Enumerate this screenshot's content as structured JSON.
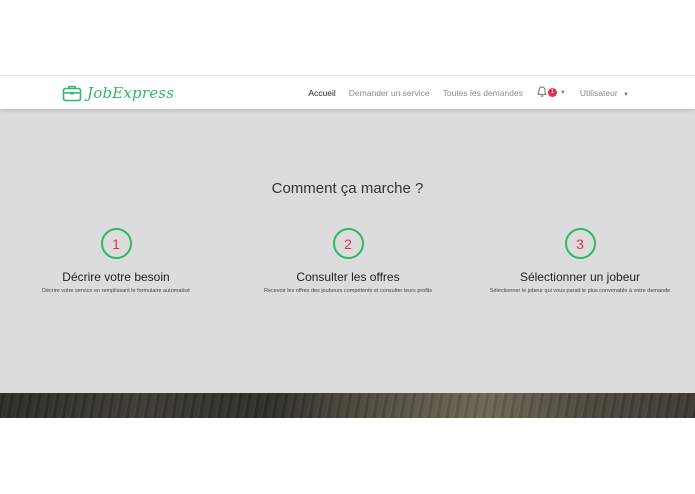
{
  "brand": {
    "name": "JobExpress",
    "color": "#2fb86a",
    "icon": "briefcase-icon"
  },
  "nav": {
    "links": [
      "Accueil",
      "Demander un service",
      "Toutes les demandes"
    ],
    "active": "Accueil",
    "notifications": {
      "icon": "bell-icon",
      "count": "1"
    },
    "user_menu": "Utilisateur"
  },
  "hero": {
    "title": "Comment ça marche ?",
    "steps": [
      {
        "number": "1",
        "title": "Décrire votre besoin",
        "description": "Décrire votre service en remplissant le formulaire automatisé"
      },
      {
        "number": "2",
        "title": "Consulter les offres",
        "description": "Recevoir les offres des joubeurs compétents et consulter leurs profils"
      },
      {
        "number": "3",
        "title": "Sélectionner un jobeur",
        "description": "Sélectionner le jobeur qui vous parait le plus convenable à votre demande"
      }
    ]
  },
  "colors": {
    "accent": "#2fb86a",
    "number": "#e2304f",
    "hero_bg": "#dcdcdc"
  }
}
